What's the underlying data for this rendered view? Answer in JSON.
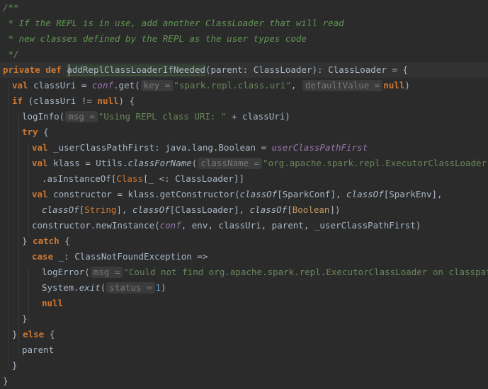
{
  "editor": {
    "lines": [
      {
        "kind": "doc_open",
        "text": "/**"
      },
      {
        "kind": "doc_text",
        "text": " * If the REPL is in use, add another ClassLoader that will read"
      },
      {
        "kind": "doc_text",
        "text": " * new classes defined by the REPL as the user types code"
      },
      {
        "kind": "doc_close",
        "text": " */"
      },
      {
        "kind": "def",
        "kw_private": "private",
        "kw_def": "def",
        "name": "addReplClassLoaderIfNeeded",
        "rest": "(parent: ClassLoader): ClassLoader = {"
      },
      {
        "kind": "val_uri",
        "kw_val": "val",
        "var": "classUri",
        "eq": " = ",
        "conf": "conf",
        "call": ".get(",
        "hint1": "key =",
        "str1": "\"spark.repl.class.uri\"",
        "comma": ", ",
        "hint2": "defaultValue =",
        "kw_null": "null",
        "close": ")"
      },
      {
        "kind": "if",
        "kw_if": "if",
        "cond": " (classUri != ",
        "kw_null": "null",
        "close": ") {"
      },
      {
        "kind": "loginfo",
        "call": "logInfo(",
        "hint": "msg =",
        "str": "\"Using REPL class URI: \"",
        "rest": " + classUri)"
      },
      {
        "kind": "try",
        "kw_try": "try",
        "rest": " {"
      },
      {
        "kind": "val_first",
        "kw_val": "val",
        "rest": " _userClassPathFirst: java.lang.Boolean = ",
        "ref": "userClassPathFirst"
      },
      {
        "kind": "val_klass",
        "kw_val": "val",
        "pre": " klass = Utils.",
        "method": "classForName",
        "paren": "(",
        "hint": "className =",
        "str": "\"org.apache.spark.repl.ExecutorClassLoader\"",
        "close": ")"
      },
      {
        "kind": "cast",
        "pre": ".asInstanceOf[",
        "cls": "Class",
        "rest": "[_ <: ClassLoader]]"
      },
      {
        "kind": "val_ctor",
        "kw_val": "val",
        "pre": " constructor = klass.getConstructor(",
        "classOf1": "classOf",
        "arg1": "[SparkConf], ",
        "classOf2": "classOf",
        "arg2": "[SparkEnv],",
        "classOf_cont": ""
      },
      {
        "kind": "ctor_cont",
        "classOf1": "classOf",
        "b1": "[",
        "t1": "String",
        "e1": "], ",
        "classOf2": "classOf",
        "arg2": "[ClassLoader], ",
        "classOf3": "classOf",
        "b3": "[",
        "t3": "Boolean",
        "e3": "])"
      },
      {
        "kind": "newinst",
        "pre": "constructor.newInstance(",
        "conf": "conf",
        "rest": ", env, classUri, parent, _userClassPathFirst)"
      },
      {
        "kind": "catch",
        "pre": "} ",
        "kw_catch": "catch",
        "rest": " {"
      },
      {
        "kind": "case",
        "kw_case": "case",
        "rest": " _: ClassNotFoundException =>"
      },
      {
        "kind": "logerror",
        "call": "logError(",
        "hint": "msg =",
        "str": "\"Could not find org.apache.spark.repl.ExecutorClassLoader on classpath!\"",
        "close": ")"
      },
      {
        "kind": "exit",
        "pre": "System.",
        "method": "exit",
        "paren": "(",
        "hint": "status =",
        "num": "1",
        "close": ")"
      },
      {
        "kind": "null",
        "kw_null": "null"
      },
      {
        "kind": "brace",
        "text": "}"
      },
      {
        "kind": "else",
        "pre": "} ",
        "kw_else": "else",
        "rest": " {"
      },
      {
        "kind": "plain",
        "text": "parent"
      },
      {
        "kind": "brace",
        "text": "}"
      },
      {
        "kind": "brace",
        "text": "}"
      }
    ]
  },
  "colors": {
    "background": "#2b2b2b",
    "current_line": "#323232",
    "comment": "#629755",
    "keyword": "#cc7832",
    "string": "#6a8759",
    "number": "#6897bb",
    "field": "#9876aa",
    "hint_bg": "#3b3b3b",
    "hint_fg": "#787878"
  }
}
